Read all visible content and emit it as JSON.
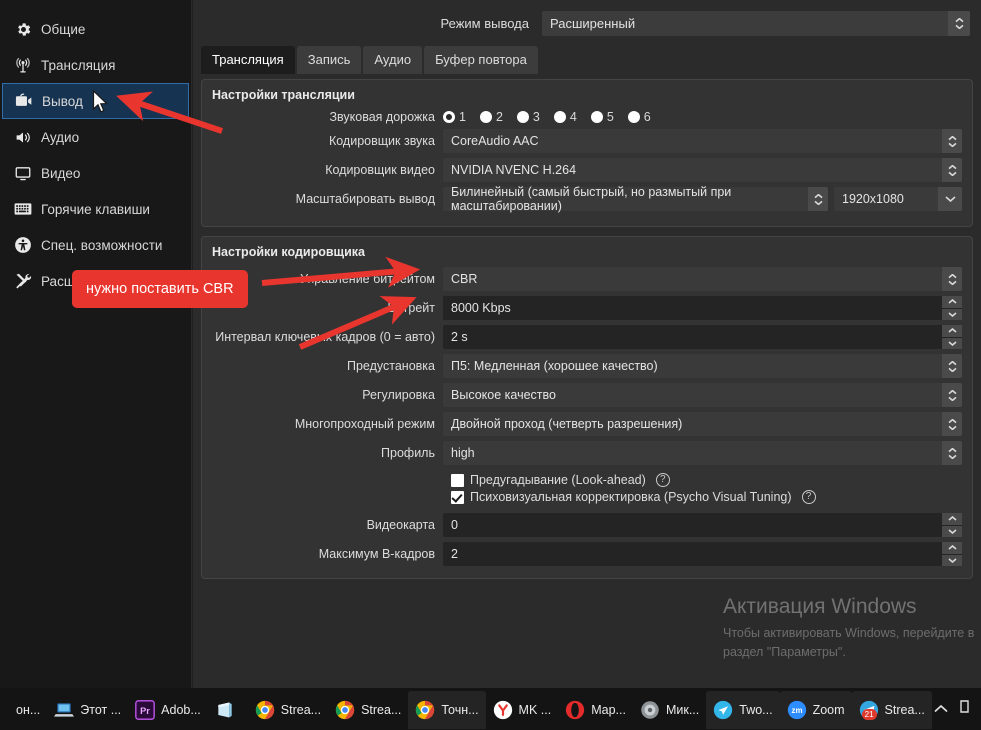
{
  "sidebar": {
    "items": [
      {
        "label": "Общие",
        "icon": "gear-icon",
        "key": "general"
      },
      {
        "label": "Трансляция",
        "icon": "broadcast-icon",
        "key": "stream"
      },
      {
        "label": "Вывод",
        "icon": "output-icon",
        "key": "output"
      },
      {
        "label": "Аудио",
        "icon": "speaker-icon",
        "key": "audio"
      },
      {
        "label": "Видео",
        "icon": "monitor-icon",
        "key": "video"
      },
      {
        "label": "Горячие клавиши",
        "icon": "keyboard-icon",
        "key": "hotkeys"
      },
      {
        "label": "Спец. возможности",
        "icon": "accessibility-icon",
        "key": "accessibility"
      },
      {
        "label": "Расширенные",
        "icon": "tools-icon",
        "key": "advanced"
      }
    ],
    "active_index": 2
  },
  "header": {
    "output_mode_label": "Режим вывода",
    "output_mode_value": "Расширенный"
  },
  "tabs": [
    {
      "label": "Трансляция",
      "active": true
    },
    {
      "label": "Запись",
      "active": false
    },
    {
      "label": "Аудио",
      "active": false
    },
    {
      "label": "Буфер повтора",
      "active": false
    }
  ],
  "stream_group": {
    "title": "Настройки трансляции",
    "audio_track_label": "Звуковая дорожка",
    "audio_tracks": [
      "1",
      "2",
      "3",
      "4",
      "5",
      "6"
    ],
    "audio_track_selected": "1",
    "audio_encoder_label": "Кодировщик звука",
    "audio_encoder_value": "CoreAudio AAC",
    "video_encoder_label": "Кодировщик видео",
    "video_encoder_value": "NVIDIA NVENC H.264",
    "rescale_label": "Масштабировать вывод",
    "rescale_value": "Билинейный (самый быстрый, но размытый при масштабировании)",
    "resolution_value": "1920x1080"
  },
  "encoder_group": {
    "title": "Настройки кодировщика",
    "rows": [
      {
        "label": "Управление битрейтом",
        "value": "CBR",
        "type": "combo"
      },
      {
        "label": "Битрейт",
        "value": "8000 Kbps",
        "type": "spin"
      },
      {
        "label": "Интервал ключевых кадров (0 = авто)",
        "value": "2 s",
        "type": "spin"
      },
      {
        "label": "Предустановка",
        "value": "П5: Медленная (хорошее качество)",
        "type": "combo"
      },
      {
        "label": "Регулировка",
        "value": "Высокое качество",
        "type": "combo"
      },
      {
        "label": "Многопроходный режим",
        "value": "Двойной проход (четверть разрешения)",
        "type": "combo"
      },
      {
        "label": "Профиль",
        "value": "high",
        "type": "combo"
      }
    ],
    "checkboxes": [
      {
        "label": "Предугадывание (Look-ahead)",
        "checked": false,
        "help": "?"
      },
      {
        "label": "Психовизуальная корректировка (Psycho Visual Tuning)",
        "checked": true,
        "help": "?"
      }
    ],
    "rows2": [
      {
        "label": "Видеокарта",
        "value": "0",
        "type": "spin"
      },
      {
        "label": "Максимум B-кадров",
        "value": "2",
        "type": "spin"
      }
    ]
  },
  "annotation": {
    "callout_text": "нужно поставить CBR",
    "callout_color": "#e8352e"
  },
  "watermark": {
    "title": "Активация Windows",
    "line1": "Чтобы активировать Windows, перейдите в",
    "line2": "раздел \"Параметры\"."
  },
  "taskbar": {
    "items": [
      {
        "label": "он...",
        "icon": "partial-icon",
        "running": false
      },
      {
        "label": "Этот ...",
        "icon": "this-pc-icon",
        "running": false
      },
      {
        "label": "Adob...",
        "icon": "premiere-icon",
        "running": false
      },
      {
        "label": "",
        "icon": "onenote-icon",
        "running": false
      },
      {
        "label": "Strea...",
        "icon": "chrome-icon",
        "running": false
      },
      {
        "label": "Strea...",
        "icon": "chrome-icon",
        "running": false
      },
      {
        "label": "Точн...",
        "icon": "chrome-icon",
        "running": true
      },
      {
        "label": "MK ...",
        "icon": "yandex-icon",
        "running": false
      },
      {
        "label": "Map...",
        "icon": "opera-icon",
        "running": false
      },
      {
        "label": "Мик...",
        "icon": "speaker-app-icon",
        "running": false
      },
      {
        "label": "Two...",
        "icon": "twodo-icon",
        "running": true
      },
      {
        "label": "Zoom",
        "icon": "zoom-icon",
        "running": true
      },
      {
        "label": "Strea...",
        "icon": "telegram-icon",
        "running": true,
        "badge": "21"
      }
    ],
    "tray_chevron": "show-hidden-icons",
    "tray_extra": "tray-icon"
  }
}
